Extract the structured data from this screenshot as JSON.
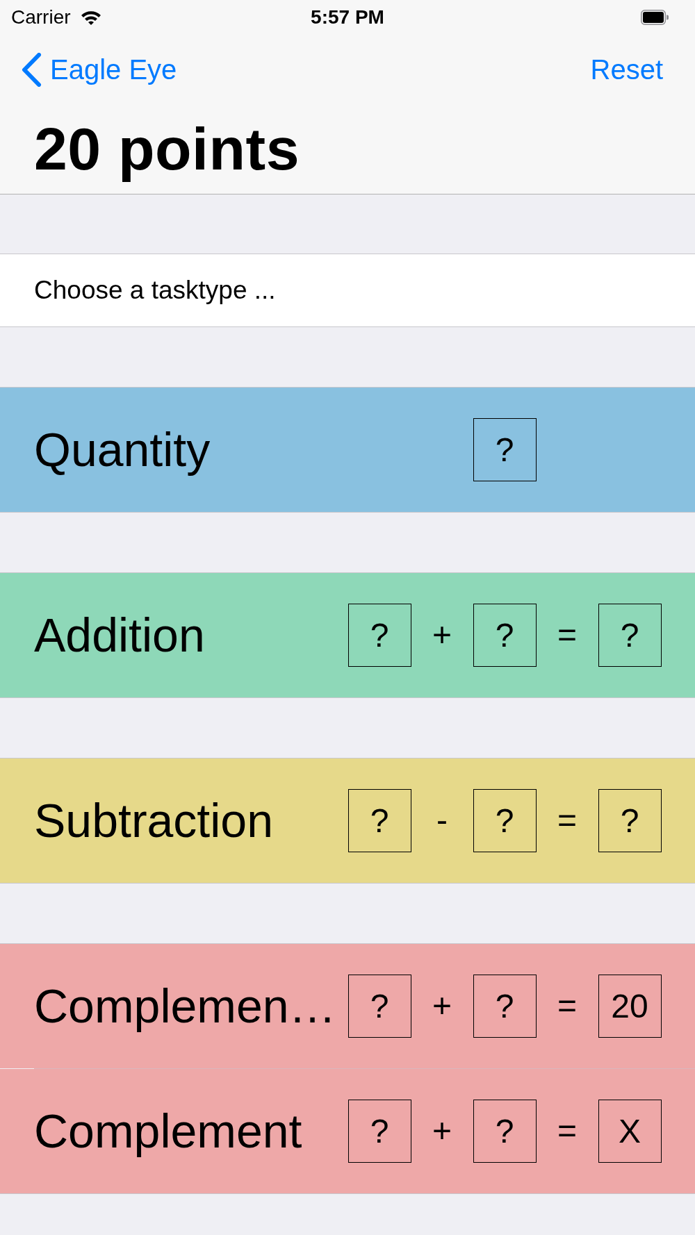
{
  "status_bar": {
    "carrier": "Carrier",
    "time": "5:57 PM"
  },
  "nav_bar": {
    "back_button": "Eagle Eye",
    "right_button": "Reset",
    "title": "20 points"
  },
  "prompt": "Choose a tasktype ...",
  "sections": [
    {
      "tasks": [
        {
          "label": "Quantity",
          "color": "#89c1e0",
          "equation": [
            {
              "kind": "box",
              "text": "?"
            }
          ]
        }
      ]
    },
    {
      "tasks": [
        {
          "label": "Addition",
          "color": "#8ed8b8",
          "equation": [
            {
              "kind": "box",
              "text": "?"
            },
            {
              "kind": "operator",
              "text": "+"
            },
            {
              "kind": "box",
              "text": "?"
            },
            {
              "kind": "operator",
              "text": "="
            },
            {
              "kind": "box",
              "text": "?"
            }
          ]
        }
      ]
    },
    {
      "tasks": [
        {
          "label": "Subtraction",
          "color": "#e6d98a",
          "equation": [
            {
              "kind": "box",
              "text": "?"
            },
            {
              "kind": "operator",
              "text": "-"
            },
            {
              "kind": "box",
              "text": "?"
            },
            {
              "kind": "operator",
              "text": "="
            },
            {
              "kind": "box",
              "text": "?"
            }
          ]
        }
      ]
    },
    {
      "tasks": [
        {
          "label": "Complemen…",
          "color": "#eea8a8",
          "equation": [
            {
              "kind": "box",
              "text": "?"
            },
            {
              "kind": "operator",
              "text": "+"
            },
            {
              "kind": "box",
              "text": "?"
            },
            {
              "kind": "operator",
              "text": "="
            },
            {
              "kind": "box",
              "text": "20"
            }
          ]
        },
        {
          "label": "Complement",
          "color": "#eea8a8",
          "equation": [
            {
              "kind": "box",
              "text": "?"
            },
            {
              "kind": "operator",
              "text": "+"
            },
            {
              "kind": "box",
              "text": "?"
            },
            {
              "kind": "operator",
              "text": "="
            },
            {
              "kind": "box",
              "text": "X"
            }
          ]
        }
      ]
    }
  ]
}
